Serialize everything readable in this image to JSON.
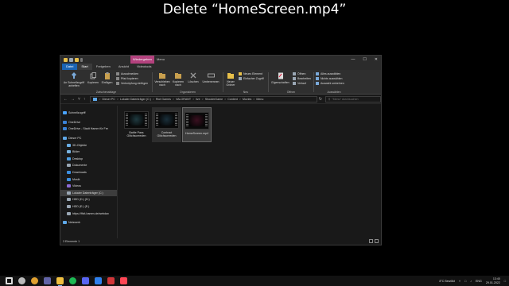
{
  "caption": "Delete “HomeScreen.mp4”",
  "window": {
    "context_tab": "Wiedergeben",
    "title": "Menu",
    "controls": [
      "—",
      "☐",
      "✕"
    ]
  },
  "ribbon_tabs": [
    "Datei",
    "Start",
    "Freigeben",
    "Ansicht",
    "Videotools"
  ],
  "ribbon": {
    "clipboard": {
      "label": "Zwischenablage",
      "pin": "An Schnellzugriff anheften",
      "copy": "Kopieren",
      "paste": "Einfügen",
      "cut": "Ausschneiden",
      "copy_path": "Pfad kopieren",
      "paste_shortcut": "Verknüpfung einfügen"
    },
    "organize": {
      "label": "Organisieren",
      "move_to": "Verschieben nach",
      "copy_to": "Kopieren nach",
      "delete": "Löschen",
      "rename": "Umbenennen"
    },
    "new": {
      "label": "Neu",
      "new_folder": "Neuer Ordner",
      "new_element": "Neues Element",
      "easy_access": "Einfacher Zugriff"
    },
    "open": {
      "label": "Öffnen",
      "properties": "Eigenschaften",
      "open": "Öffnen",
      "edit": "Bearbeiten",
      "history": "Verlauf"
    },
    "select": {
      "label": "Auswählen",
      "select_all": "Alles auswählen",
      "select_none": "Nichts auswählen",
      "invert": "Auswahl umkehren"
    }
  },
  "address": {
    "crumbs": [
      "Dieser PC",
      "Lokaler Datenträger (C:)",
      "Riot Games",
      "VALORANT",
      "live",
      "ShooterGame",
      "Content",
      "Movies",
      "Menu"
    ],
    "search_placeholder": "\"Menu\" durchsuchen"
  },
  "sidebar": [
    {
      "label": "Schnellzugriff",
      "icon": "star-icon",
      "color": "#4aa3ff",
      "indent": 0
    },
    {
      "label": "OneDrive",
      "icon": "cloud-icon",
      "color": "#3b82d6",
      "indent": 0
    },
    {
      "label": "OneDrive - Stadt Hamm für Fre",
      "icon": "cloud-icon",
      "color": "#3b82d6",
      "indent": 0
    },
    {
      "label": "Dieser PC",
      "icon": "pc-icon",
      "color": "#5fa8e8",
      "indent": 0
    },
    {
      "label": "3D-Objekte",
      "icon": "cube-icon",
      "color": "#6aaee6",
      "indent": 1
    },
    {
      "label": "Bilder",
      "icon": "pictures-icon",
      "color": "#79b3e0",
      "indent": 1
    },
    {
      "label": "Desktop",
      "icon": "desktop-icon",
      "color": "#4d9de0",
      "indent": 1
    },
    {
      "label": "Dokumente",
      "icon": "documents-icon",
      "color": "#9aa7b4",
      "indent": 1
    },
    {
      "label": "Downloads",
      "icon": "download-icon",
      "color": "#3c8ee0",
      "indent": 1
    },
    {
      "label": "Musik",
      "icon": "music-icon",
      "color": "#3c8ee0",
      "indent": 1
    },
    {
      "label": "Videos",
      "icon": "video-icon",
      "color": "#8c6bd6",
      "indent": 1
    },
    {
      "label": "Lokaler Datenträger (C:)",
      "icon": "drive-icon",
      "color": "#9aa7b4",
      "indent": 1,
      "selected": true
    },
    {
      "label": "HDD (D:) (D:)",
      "icon": "drive-icon",
      "color": "#9aa7b4",
      "indent": 1
    },
    {
      "label": "HDD (E:) (E:)",
      "icon": "drive-icon",
      "color": "#9aa7b4",
      "indent": 1
    },
    {
      "label": "https://ffcit-hamm.de/webdav",
      "icon": "network-drive-icon",
      "color": "#9aa7b4",
      "indent": 1
    },
    {
      "label": "Netzwerk",
      "icon": "network-icon",
      "color": "#5fa8e8",
      "indent": 0
    }
  ],
  "files": [
    {
      "name": "Battle Pass Glitchscreeden",
      "thumb": "#1f3a40",
      "state": "normal"
    },
    {
      "name": "Contract Glitchscreeden",
      "thumb": "#1a2f3a",
      "state": "hover"
    },
    {
      "name": "HomeScreen.mp4",
      "thumb": "#3a1020",
      "state": "selected"
    }
  ],
  "status": "3 Elemente  1",
  "taskbar": {
    "apps": [
      {
        "name": "start-icon",
        "color": "#dddddd"
      },
      {
        "name": "search-icon",
        "color": "#bbbbbb"
      },
      {
        "name": "chrome-icon",
        "color": "#e0a030"
      },
      {
        "name": "teams-icon",
        "color": "#6264a7"
      },
      {
        "name": "file-explorer-icon",
        "color": "#f0c040",
        "running": true
      },
      {
        "name": "spotify-icon",
        "color": "#1db954"
      },
      {
        "name": "discord-icon",
        "color": "#5865f2"
      },
      {
        "name": "vscode-icon",
        "color": "#2f80ed"
      },
      {
        "name": "riot-client-icon",
        "color": "#d13639"
      },
      {
        "name": "valorant-icon",
        "color": "#ff4655"
      }
    ],
    "weather": "8°C  Bewölkt",
    "lang": "ENG",
    "time": "13:40",
    "date": "29.01.2022"
  }
}
